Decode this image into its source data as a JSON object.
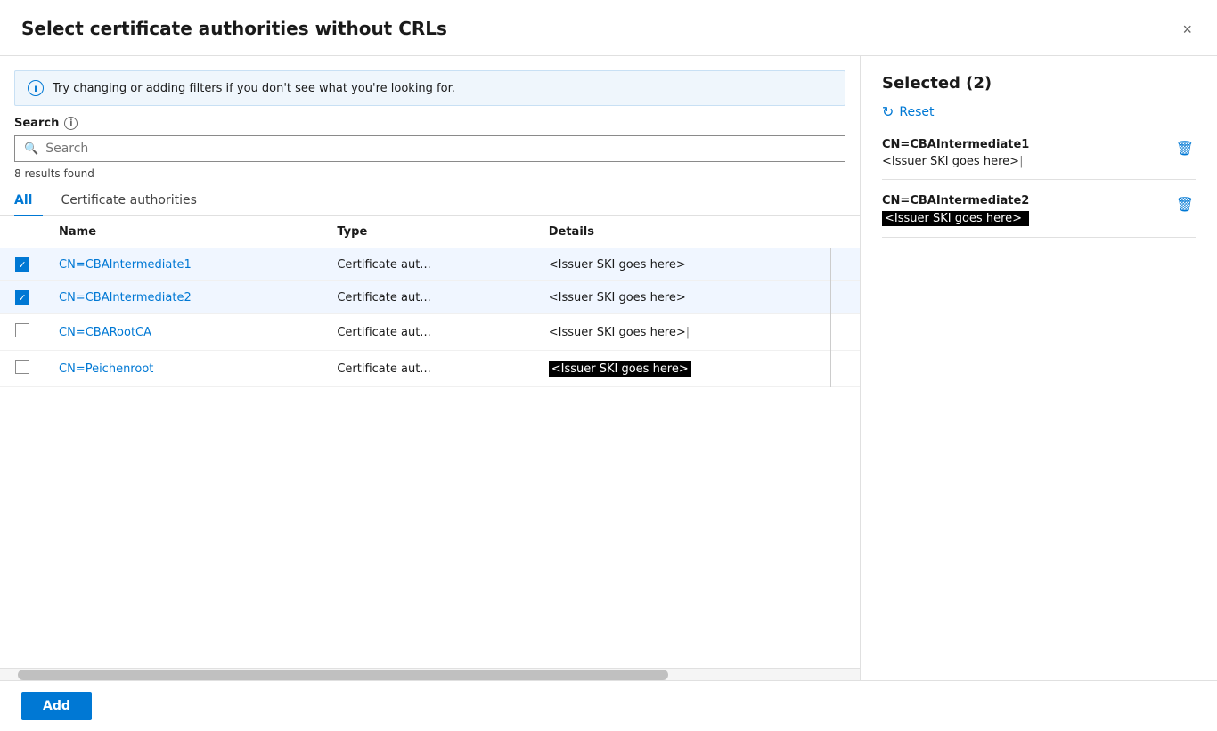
{
  "dialog": {
    "title": "Select certificate authorities without CRLs",
    "close_label": "×"
  },
  "info_banner": {
    "text": "Try changing or adding filters if you don't see what you're looking for."
  },
  "search": {
    "label": "Search",
    "placeholder": "Search",
    "results_count": "8 results found"
  },
  "tabs": [
    {
      "id": "all",
      "label": "All",
      "active": true
    },
    {
      "id": "ca",
      "label": "Certificate authorities",
      "active": false
    }
  ],
  "table": {
    "columns": [
      "",
      "Name",
      "Type",
      "Details",
      ""
    ],
    "rows": [
      {
        "checked": true,
        "name": "CN=CBAIntermediate1",
        "type": "Certificate aut...",
        "details": "<Issuer SKI goes here>",
        "details_style": "normal",
        "selected": true
      },
      {
        "checked": true,
        "name": "CN=CBAIntermediate2",
        "type": "Certificate aut...",
        "details": "<Issuer SKI goes here>",
        "details_style": "normal",
        "selected": true
      },
      {
        "checked": false,
        "name": "CN=CBARootCA",
        "type": "Certificate aut...",
        "details": "<Issuer SKI goes here>",
        "details_style": "cursor",
        "selected": false
      },
      {
        "checked": false,
        "name": "CN=Peichenroot",
        "type": "Certificate aut...",
        "details": "<Issuer SKI goes here>",
        "details_style": "highlighted",
        "selected": false
      }
    ]
  },
  "selected_panel": {
    "title": "Selected (2)",
    "reset_label": "Reset",
    "items": [
      {
        "name": "CN=CBAIntermediate1",
        "detail": "<Issuer SKI goes here>",
        "detail_style": "cursor"
      },
      {
        "name": "CN=CBAIntermediate2",
        "detail": "<Issuer SKI goes here>",
        "detail_style": "blacked-out"
      }
    ]
  },
  "footer": {
    "add_label": "Add"
  }
}
